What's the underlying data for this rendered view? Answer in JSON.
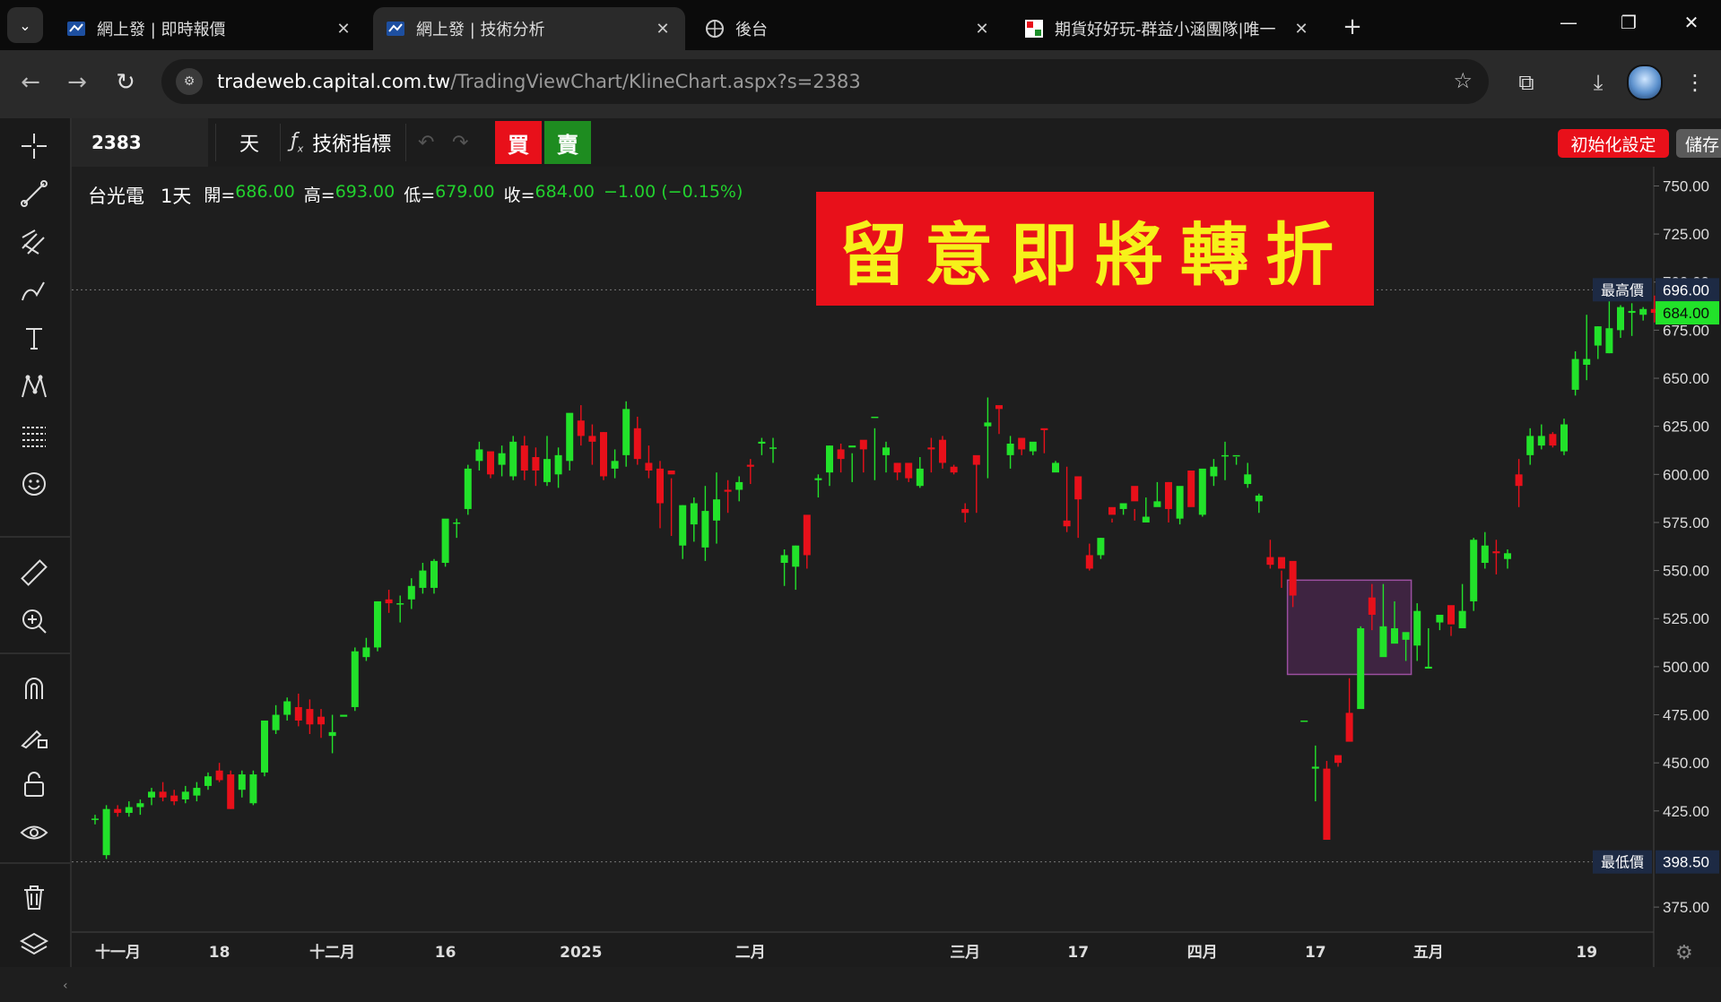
{
  "browser": {
    "tabs": [
      {
        "title": "網上發 | 即時報價",
        "active": false
      },
      {
        "title": "網上發 | 技術分析",
        "active": true
      },
      {
        "title": "後台",
        "active": false
      },
      {
        "title": "期貨好好玩-群益小涵團隊|唯一",
        "active": false
      }
    ],
    "url_host": "tradeweb.capital.com.tw",
    "url_path": "/TradingViewChart/KlineChart.aspx?s=2383"
  },
  "toolbar": {
    "symbol": "2383",
    "interval": "天",
    "indicators_label": "技術指標",
    "buy_label": "買",
    "sell_label": "賣",
    "reset_label": "初始化設定",
    "save_label": "儲存"
  },
  "legend": {
    "name": "台光電",
    "interval": "1天",
    "open_label": "開=",
    "open": "686.00",
    "high_label": "高=",
    "high": "693.00",
    "low_label": "低=",
    "low": "679.00",
    "close_label": "收=",
    "close": "684.00",
    "change": "−1.00 (−0.15%)"
  },
  "banner_text": "留意即將轉折",
  "price_tags": {
    "highest_label": "最高價",
    "highest_value": "696.00",
    "current_value": "684.00",
    "lowest_label": "最低價",
    "lowest_value": "398.50"
  },
  "colors": {
    "up": "#22e22a",
    "down": "#e8101a",
    "background": "#1e1e1e",
    "banner_bg": "#e8101a",
    "banner_text": "#f6f11a",
    "highlight_box": "#5a2a5e"
  },
  "chart_data": {
    "type": "candlestick",
    "y_ticks": [
      750,
      725,
      700,
      675,
      650,
      625,
      600,
      575,
      550,
      525,
      500,
      475,
      450,
      425,
      375
    ],
    "y_range": [
      362,
      760
    ],
    "x_tick_labels": [
      {
        "label": "十一月",
        "i": 0
      },
      {
        "label": "18",
        "i": 11
      },
      {
        "label": "十二月",
        "i": 21
      },
      {
        "label": "16",
        "i": 31
      },
      {
        "label": "2025",
        "i": 43
      },
      {
        "label": "二月",
        "i": 58
      },
      {
        "label": "三月",
        "i": 77
      },
      {
        "label": "17",
        "i": 87
      },
      {
        "label": "四月",
        "i": 98
      },
      {
        "label": "17",
        "i": 108
      },
      {
        "label": "五月",
        "i": 118
      },
      {
        "label": "19",
        "i": 132
      }
    ],
    "highest": 696.0,
    "lowest": 398.5,
    "highlight_range": {
      "from": 106,
      "to": 116,
      "low": 496,
      "high": 545
    },
    "candles": [
      [
        421,
        423,
        418,
        421
      ],
      [
        402,
        428,
        400,
        426
      ],
      [
        426,
        428,
        422,
        424
      ],
      [
        424,
        430,
        422,
        427
      ],
      [
        427,
        431,
        423,
        429
      ],
      [
        432,
        437,
        428,
        435
      ],
      [
        435,
        440,
        430,
        432
      ],
      [
        433,
        436,
        428,
        430
      ],
      [
        431,
        438,
        429,
        435
      ],
      [
        433,
        440,
        430,
        437
      ],
      [
        438,
        445,
        436,
        443
      ],
      [
        446,
        450,
        440,
        441
      ],
      [
        444,
        446,
        426,
        426
      ],
      [
        436,
        446,
        432,
        444
      ],
      [
        429,
        446,
        428,
        444
      ],
      [
        445,
        468,
        443,
        472
      ],
      [
        467,
        480,
        465,
        475
      ],
      [
        475,
        484,
        472,
        482
      ],
      [
        479,
        486,
        469,
        472
      ],
      [
        478,
        483,
        465,
        470
      ],
      [
        474,
        478,
        463,
        470
      ],
      [
        464,
        475,
        455,
        466
      ],
      [
        474,
        470,
        470,
        475
      ],
      [
        479,
        510,
        477,
        508
      ],
      [
        505,
        515,
        503,
        510
      ],
      [
        510,
        534,
        508,
        534
      ],
      [
        535,
        540,
        528,
        533
      ],
      [
        533,
        537,
        523,
        533
      ],
      [
        535,
        546,
        530,
        542
      ],
      [
        541,
        554,
        538,
        550
      ],
      [
        541,
        556,
        538,
        555
      ],
      [
        554,
        575,
        552,
        577
      ],
      [
        575,
        577,
        567,
        575
      ],
      [
        582,
        605,
        579,
        603
      ],
      [
        607,
        617,
        602,
        613
      ],
      [
        612,
        609,
        598,
        600
      ],
      [
        605,
        615,
        599,
        611
      ],
      [
        599,
        620,
        597,
        617
      ],
      [
        615,
        620,
        597,
        602
      ],
      [
        609,
        614,
        594,
        602
      ],
      [
        596,
        620,
        594,
        608
      ],
      [
        600,
        614,
        593,
        610
      ],
      [
        607,
        630,
        602,
        632
      ],
      [
        628,
        636,
        615,
        620
      ],
      [
        620,
        626,
        605,
        617
      ],
      [
        622,
        622,
        597,
        599
      ],
      [
        603,
        613,
        598,
        607
      ],
      [
        610,
        638,
        604,
        634
      ],
      [
        624,
        630,
        605,
        608
      ],
      [
        606,
        615,
        598,
        602
      ],
      [
        603,
        607,
        572,
        585
      ],
      [
        602,
        598,
        568,
        600
      ],
      [
        563,
        584,
        556,
        584
      ],
      [
        574,
        588,
        565,
        585
      ],
      [
        562,
        594,
        555,
        581
      ],
      [
        576,
        601,
        564,
        587
      ],
      [
        592,
        597,
        580,
        591
      ],
      [
        592,
        599,
        586,
        596
      ],
      [
        605,
        608,
        595,
        604
      ],
      [
        616,
        619,
        610,
        617
      ],
      [
        614,
        619,
        606,
        614
      ],
      [
        554,
        561,
        542,
        558
      ],
      [
        552,
        563,
        540,
        563
      ],
      [
        579,
        574,
        551,
        558
      ],
      [
        597,
        600,
        588,
        598
      ],
      [
        601,
        615,
        594,
        615
      ],
      [
        613,
        616,
        601,
        608
      ],
      [
        614,
        611,
        596,
        615
      ],
      [
        618,
        615,
        601,
        613
      ],
      [
        630,
        624,
        597,
        630
      ],
      [
        610,
        617,
        601,
        614
      ],
      [
        606,
        606,
        597,
        601
      ],
      [
        606,
        604,
        596,
        598
      ],
      [
        594,
        609,
        593,
        603
      ],
      [
        614,
        619,
        601,
        613
      ],
      [
        618,
        620,
        603,
        606
      ],
      [
        604,
        605,
        600,
        601
      ],
      [
        582,
        585,
        575,
        580
      ],
      [
        610,
        606,
        580,
        605
      ],
      [
        625,
        640,
        598,
        627
      ],
      [
        636,
        634,
        621,
        634
      ],
      [
        610,
        620,
        603,
        616
      ],
      [
        619,
        614,
        610,
        613
      ],
      [
        612,
        615,
        610,
        617
      ],
      [
        624,
        623,
        611,
        623
      ],
      [
        601,
        607,
        602,
        606
      ],
      [
        576,
        604,
        570,
        573
      ],
      [
        599,
        590,
        567,
        587
      ],
      [
        558,
        564,
        550,
        551
      ],
      [
        558,
        567,
        556,
        567
      ],
      [
        583,
        577,
        575,
        579
      ],
      [
        582,
        585,
        579,
        585
      ],
      [
        594,
        576,
        582,
        586
      ],
      [
        575,
        588,
        577,
        578
      ],
      [
        583,
        596,
        584,
        586
      ],
      [
        596,
        596,
        575,
        582
      ],
      [
        577,
        591,
        574,
        594
      ],
      [
        602,
        597,
        585,
        583
      ],
      [
        579,
        601,
        578,
        603
      ],
      [
        599,
        608,
        594,
        604
      ],
      [
        610,
        617,
        597,
        610
      ],
      [
        610,
        609,
        605,
        610
      ],
      [
        595,
        606,
        593,
        600
      ],
      [
        586,
        590,
        580,
        589
      ],
      [
        557,
        566,
        551,
        553
      ],
      [
        557,
        550,
        541,
        551
      ],
      [
        555,
        554,
        531,
        537
      ],
      [
        472,
        472,
        472,
        472
      ],
      [
        447,
        459,
        430,
        448
      ],
      [
        447,
        451,
        410,
        410
      ],
      [
        454,
        450,
        448,
        450
      ],
      [
        476,
        494,
        474,
        461
      ],
      [
        478,
        521,
        516,
        520
      ],
      [
        536,
        543,
        519,
        527
      ],
      [
        505,
        543,
        515,
        521
      ],
      [
        512,
        534,
        516,
        520
      ],
      [
        514,
        517,
        503,
        518
      ],
      [
        511,
        533,
        503,
        529
      ],
      [
        499,
        520,
        499,
        500
      ],
      [
        523,
        526,
        519,
        527
      ],
      [
        532,
        521,
        516,
        522
      ],
      [
        520,
        543,
        526,
        529
      ],
      [
        534,
        567,
        529,
        566
      ],
      [
        554,
        570,
        551,
        563
      ],
      [
        560,
        566,
        548,
        559
      ],
      [
        556,
        561,
        551,
        559
      ],
      [
        600,
        608,
        583,
        594
      ],
      [
        610,
        624,
        605,
        620
      ],
      [
        615,
        626,
        613,
        620
      ],
      [
        621,
        622,
        614,
        615
      ],
      [
        612,
        629,
        610,
        626
      ],
      [
        644,
        664,
        641,
        660
      ],
      [
        657,
        683,
        649,
        660
      ],
      [
        667,
        677,
        660,
        677
      ],
      [
        663,
        694,
        663,
        676
      ],
      [
        675,
        688,
        671,
        687
      ],
      [
        684,
        689,
        672,
        685
      ],
      [
        683,
        687,
        680,
        686
      ],
      [
        686,
        693,
        679,
        684
      ]
    ]
  }
}
